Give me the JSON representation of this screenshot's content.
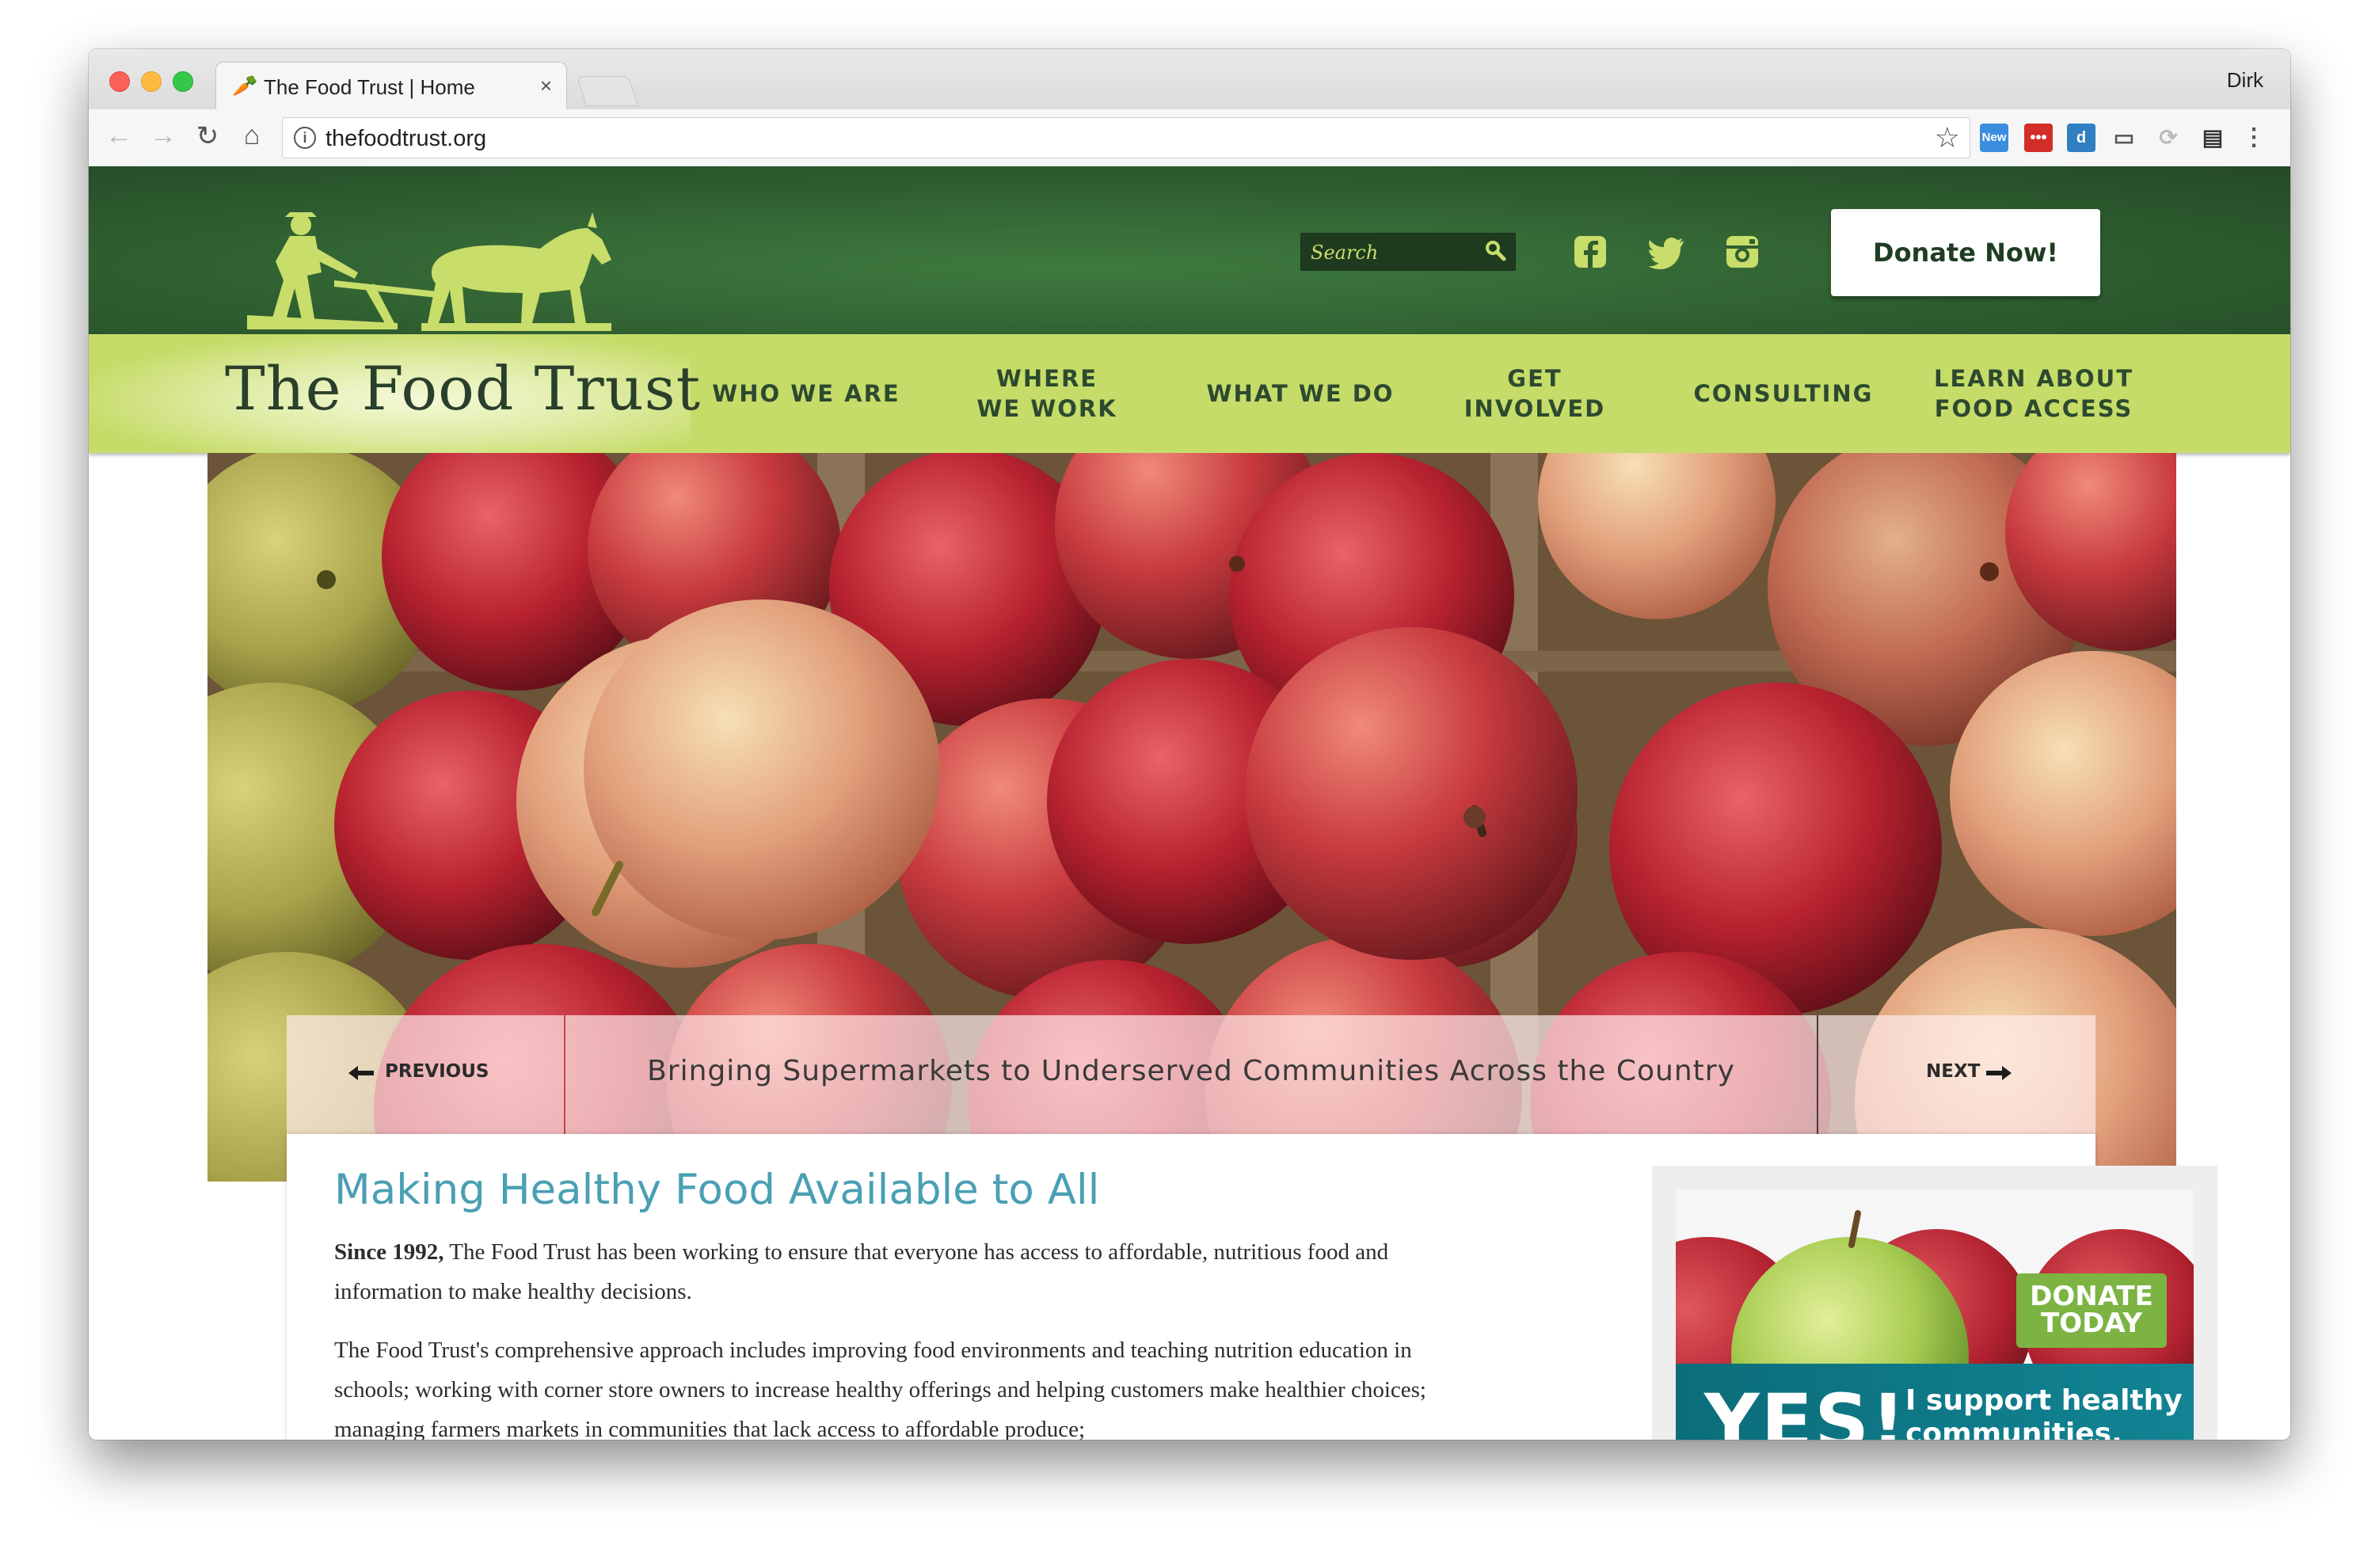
{
  "browser": {
    "tab_title": "The Food Trust | Home",
    "tab_close": "×",
    "profile_name": "Dirk",
    "url": "thefoodtrust.org",
    "extensions": [
      {
        "name": "new-badge-extension",
        "label": "New",
        "color": "#3b8de0"
      },
      {
        "name": "lastpass-extension",
        "label": "•••",
        "color": "#d32d27"
      },
      {
        "name": "d-extension",
        "label": "d",
        "color": "#2f7fc1"
      }
    ]
  },
  "site": {
    "colors": {
      "header_green": "#2f5f31",
      "nav_green": "#c6dc69",
      "accent_yellow_green": "#c8dd6a",
      "title_teal": "#4a9fb3"
    },
    "search": {
      "placeholder": "Search"
    },
    "social": [
      "facebook-icon",
      "twitter-icon",
      "instagram-icon"
    ],
    "donate_label": "Donate Now!",
    "brand": "The Food Trust",
    "nav": [
      {
        "line1": "WHO WE ARE",
        "line2": ""
      },
      {
        "line1": "WHERE",
        "line2": "WE WORK"
      },
      {
        "line1": "WHAT WE DO",
        "line2": ""
      },
      {
        "line1": "GET",
        "line2": "INVOLVED"
      },
      {
        "line1": "CONSULTING",
        "line2": ""
      },
      {
        "line1": "LEARN ABOUT",
        "line2": "FOOD ACCESS"
      }
    ],
    "slider": {
      "prev_label": "PREVIOUS",
      "next_label": "NEXT",
      "caption": "Bringing Supermarkets to Underserved Communities Across the Country"
    },
    "main": {
      "title": "Making Healthy Food Available to All",
      "p1_bold": "Since 1992,",
      "p1_text": " The Food Trust has been working to ensure that everyone has access to affordable, nutritious food and information to make healthy decisions.",
      "p2_text": "The Food Trust's comprehensive approach includes improving food environments and teaching nutrition education in schools; working with corner store owners to increase healthy offerings and helping customers make healthier choices; managing farmers markets in communities that lack access to affordable produce;"
    },
    "promo": {
      "badge_line1": "DONATE",
      "badge_line2": "TODAY",
      "yes": "YES!",
      "tagline": "I support healthy communities."
    }
  }
}
